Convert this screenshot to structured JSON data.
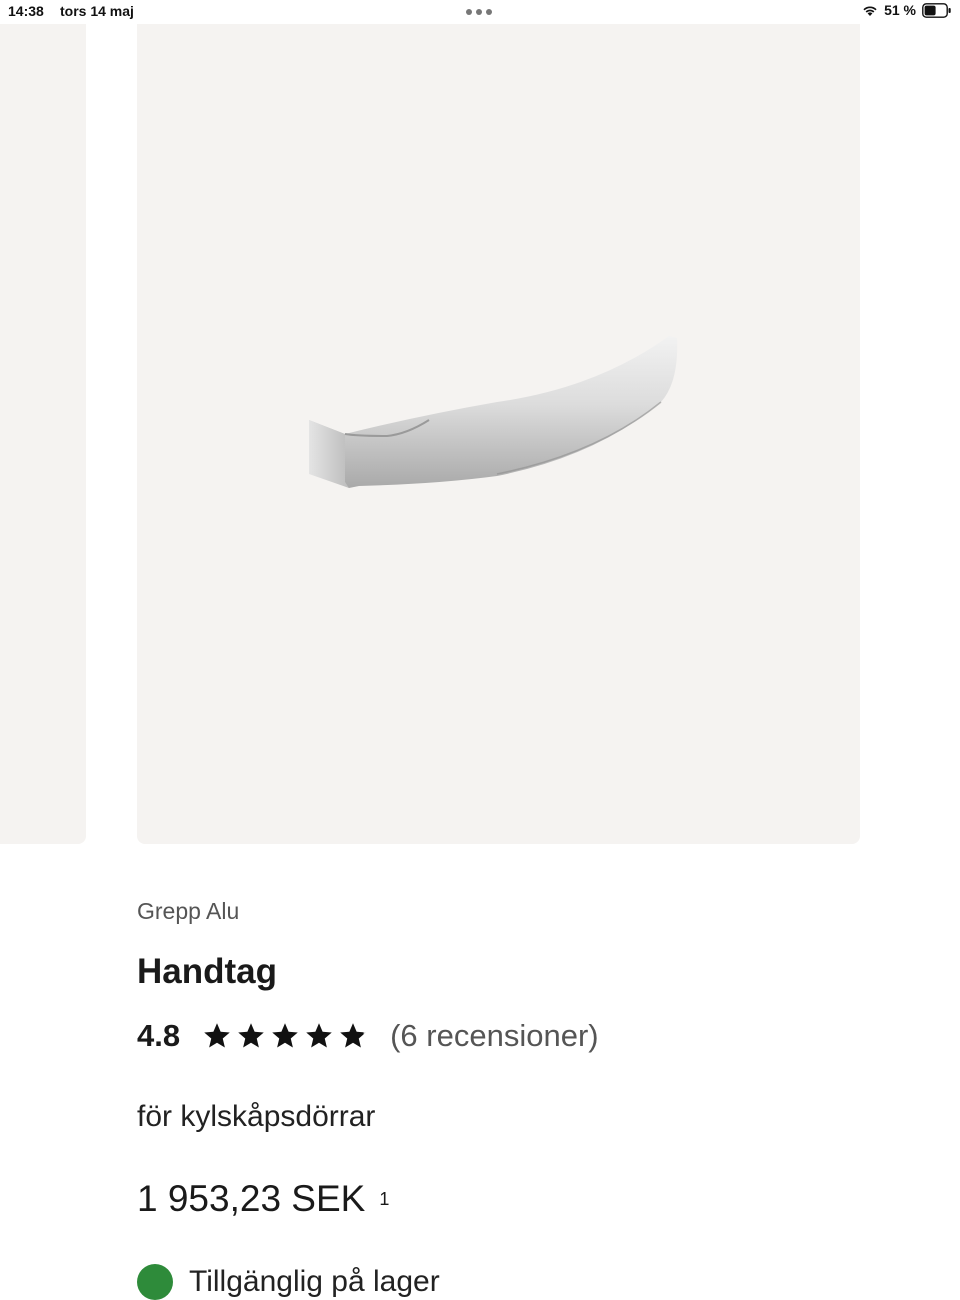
{
  "status_bar": {
    "time": "14:38",
    "date": "tors 14 maj",
    "battery": "51 %"
  },
  "product": {
    "brand": "Grepp Alu",
    "title": "Handtag",
    "rating": "4.8",
    "rating_fraction": 0.96,
    "reviews": "(6 recensioner)",
    "description": "för kylskåpsdörrar",
    "price": "1 953,23 SEK",
    "price_footnote": "1",
    "availability": "Tillgänglig på lager"
  },
  "colors": {
    "image_background": "#f5f3f1",
    "availability_green": "#2e8b3a"
  },
  "icons": [
    "wifi-icon",
    "battery-icon",
    "star-icon",
    "product-handle-image"
  ]
}
